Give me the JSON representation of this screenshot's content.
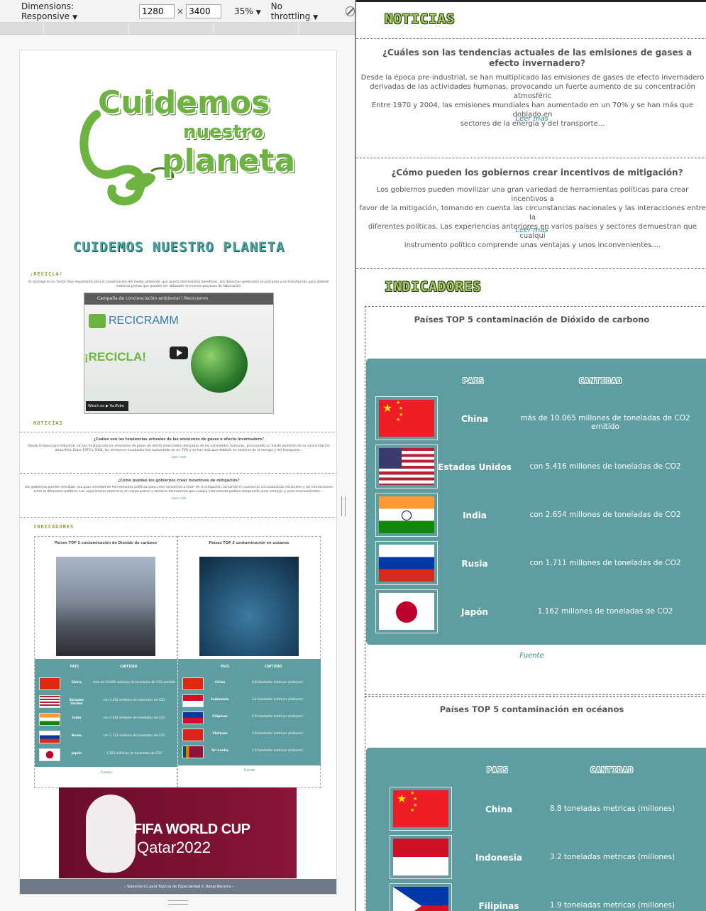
{
  "toolbar": {
    "dimensions_label": "Dimensions: Responsive",
    "width_value": "1280",
    "height_value": "3400",
    "times": "×",
    "zoom": "35%",
    "throttling": "No throttling"
  },
  "preview": {
    "logo_line1": "Cuidemos",
    "logo_line2": "nuestro",
    "logo_line3": "planeta",
    "site_title": "CUIDEMOS NUESTRO PLANETA",
    "recicla_heading": "¡RECICLA!",
    "recicla_text": "El reciclaje es un factor muy importante para la conservación del medio ambiente, que aporta interesantes beneficios. Los desechos generados se procesan y se transforman para obtener materias primas que pueden ser utilizadas en nuevos procesos de fabricación.",
    "video_title": "Campaña de concienciación ambiental | Recicramm",
    "video_brand": "RECICRAMM",
    "video_recicla": "¡RECICLA!",
    "video_watch": "Watch on ▶ YouTube",
    "noticias_heading": "NOTICIAS",
    "indicadores_heading": "INDICADORES",
    "ind1_title": "Países TOP 5 contaminación de Dióxido de carbono",
    "ind2_title": "Países TOP 5 contaminación en océanos",
    "th_pais": "PAIS",
    "th_cantidad": "CANTIDAD",
    "ind1_rows": [
      {
        "pais": "China",
        "valor": "más de 10.065 millones de toneladas de CO2 emitido"
      },
      {
        "pais": "Estados Unidos",
        "valor": "con 5.416 millones de toneladas de CO2"
      },
      {
        "pais": "India",
        "valor": "con 2.654 millones de toneladas de CO2"
      },
      {
        "pais": "Rusia",
        "valor": "con 1.711 millones de toneladas de CO2"
      },
      {
        "pais": "Japón",
        "valor": "1.162 millones de toneladas de CO2"
      }
    ],
    "ind2_rows": [
      {
        "pais": "China",
        "valor": "8.8 toneladas metricas (millones)"
      },
      {
        "pais": "Indonesia",
        "valor": "3.2 toneladas metricas (millones)"
      },
      {
        "pais": "Filipinas",
        "valor": "1.9 toneladas metricas (millones)"
      },
      {
        "pais": "Vietnam",
        "valor": "1.8 toneladas metricas (millones)"
      },
      {
        "pais": "Sri Lanka",
        "valor": "1.6 toneladas metricas (millones)"
      }
    ],
    "fuente": "Fuente",
    "fifa_line1": "FIFA WORLD CUP",
    "fifa_line2": "Qatar2022",
    "footer": "– Solemne 01 para Topicos de Especialidad II, Rangi Becerra –"
  },
  "main": {
    "noticias_title": "NOTICIAS",
    "news": [
      {
        "question": "¿Cuáles son las tendencias actuales de las emisiones de gases a efecto invernadero?",
        "body": "Desde la época pre-industrial, se han multiplicado las emisiones de gases de efecto invernadero\nderivadas de las actividades humanas, provocando un fuerte aumento de su concentración atmosféric\nEntre 1970 y 2004, las emisiones mundiales han aumentado en un 70% y se han más que doblado en\nsectores de la energía y del transporte...",
        "leer_mas": "Leer más"
      },
      {
        "question": "¿Cómo pueden los gobiernos crear incentivos de mitigación?",
        "body": "Los gobiernos pueden movilizar una gran variedad de herramientas políticas para crear incentivos a\nfavor de la mitigación, tomando en cuenta las circunstancias nacionales y las interacciones entre la\ndiferentes políticas. Las experiencias anteriores en varios países y sectores demuestran que cualqui\ninstrumento político comprende unas ventajas y unos inconvenientes....",
        "leer_mas": "Leer más"
      }
    ],
    "indicadores_title": "INDICADORES",
    "co2_title": "Países TOP 5 contaminación de Dióxido de carbono",
    "th_pais": "PAIS",
    "th_cantidad": "CANTIDAD",
    "co2_rows": [
      {
        "pais": "China",
        "valor": "más de 10.065 millones de toneladas de CO2 emitido"
      },
      {
        "pais": "Estados Unidos",
        "valor": "con 5.416 millones de toneladas de CO2"
      },
      {
        "pais": "India",
        "valor": "con 2.654 millones de toneladas de CO2"
      },
      {
        "pais": "Rusia",
        "valor": "con 1.711 millones de toneladas de CO2"
      },
      {
        "pais": "Japón",
        "valor": "1.162 millones de toneladas de CO2"
      }
    ],
    "fuente": "Fuente",
    "ocean_title": "Países TOP 5 contaminación en océanos",
    "ocean_rows": [
      {
        "pais": "China",
        "valor": "8.8 toneladas metricas (millones)"
      },
      {
        "pais": "Indonesia",
        "valor": "3.2 toneladas metricas (millones)"
      },
      {
        "pais": "Filipinas",
        "valor": "1.9 toneladas metricas (millones)"
      }
    ]
  },
  "colors": {
    "teal_table": "#5f9ea0",
    "title_green": "#a5c95a",
    "link": "#2f8a8a"
  }
}
